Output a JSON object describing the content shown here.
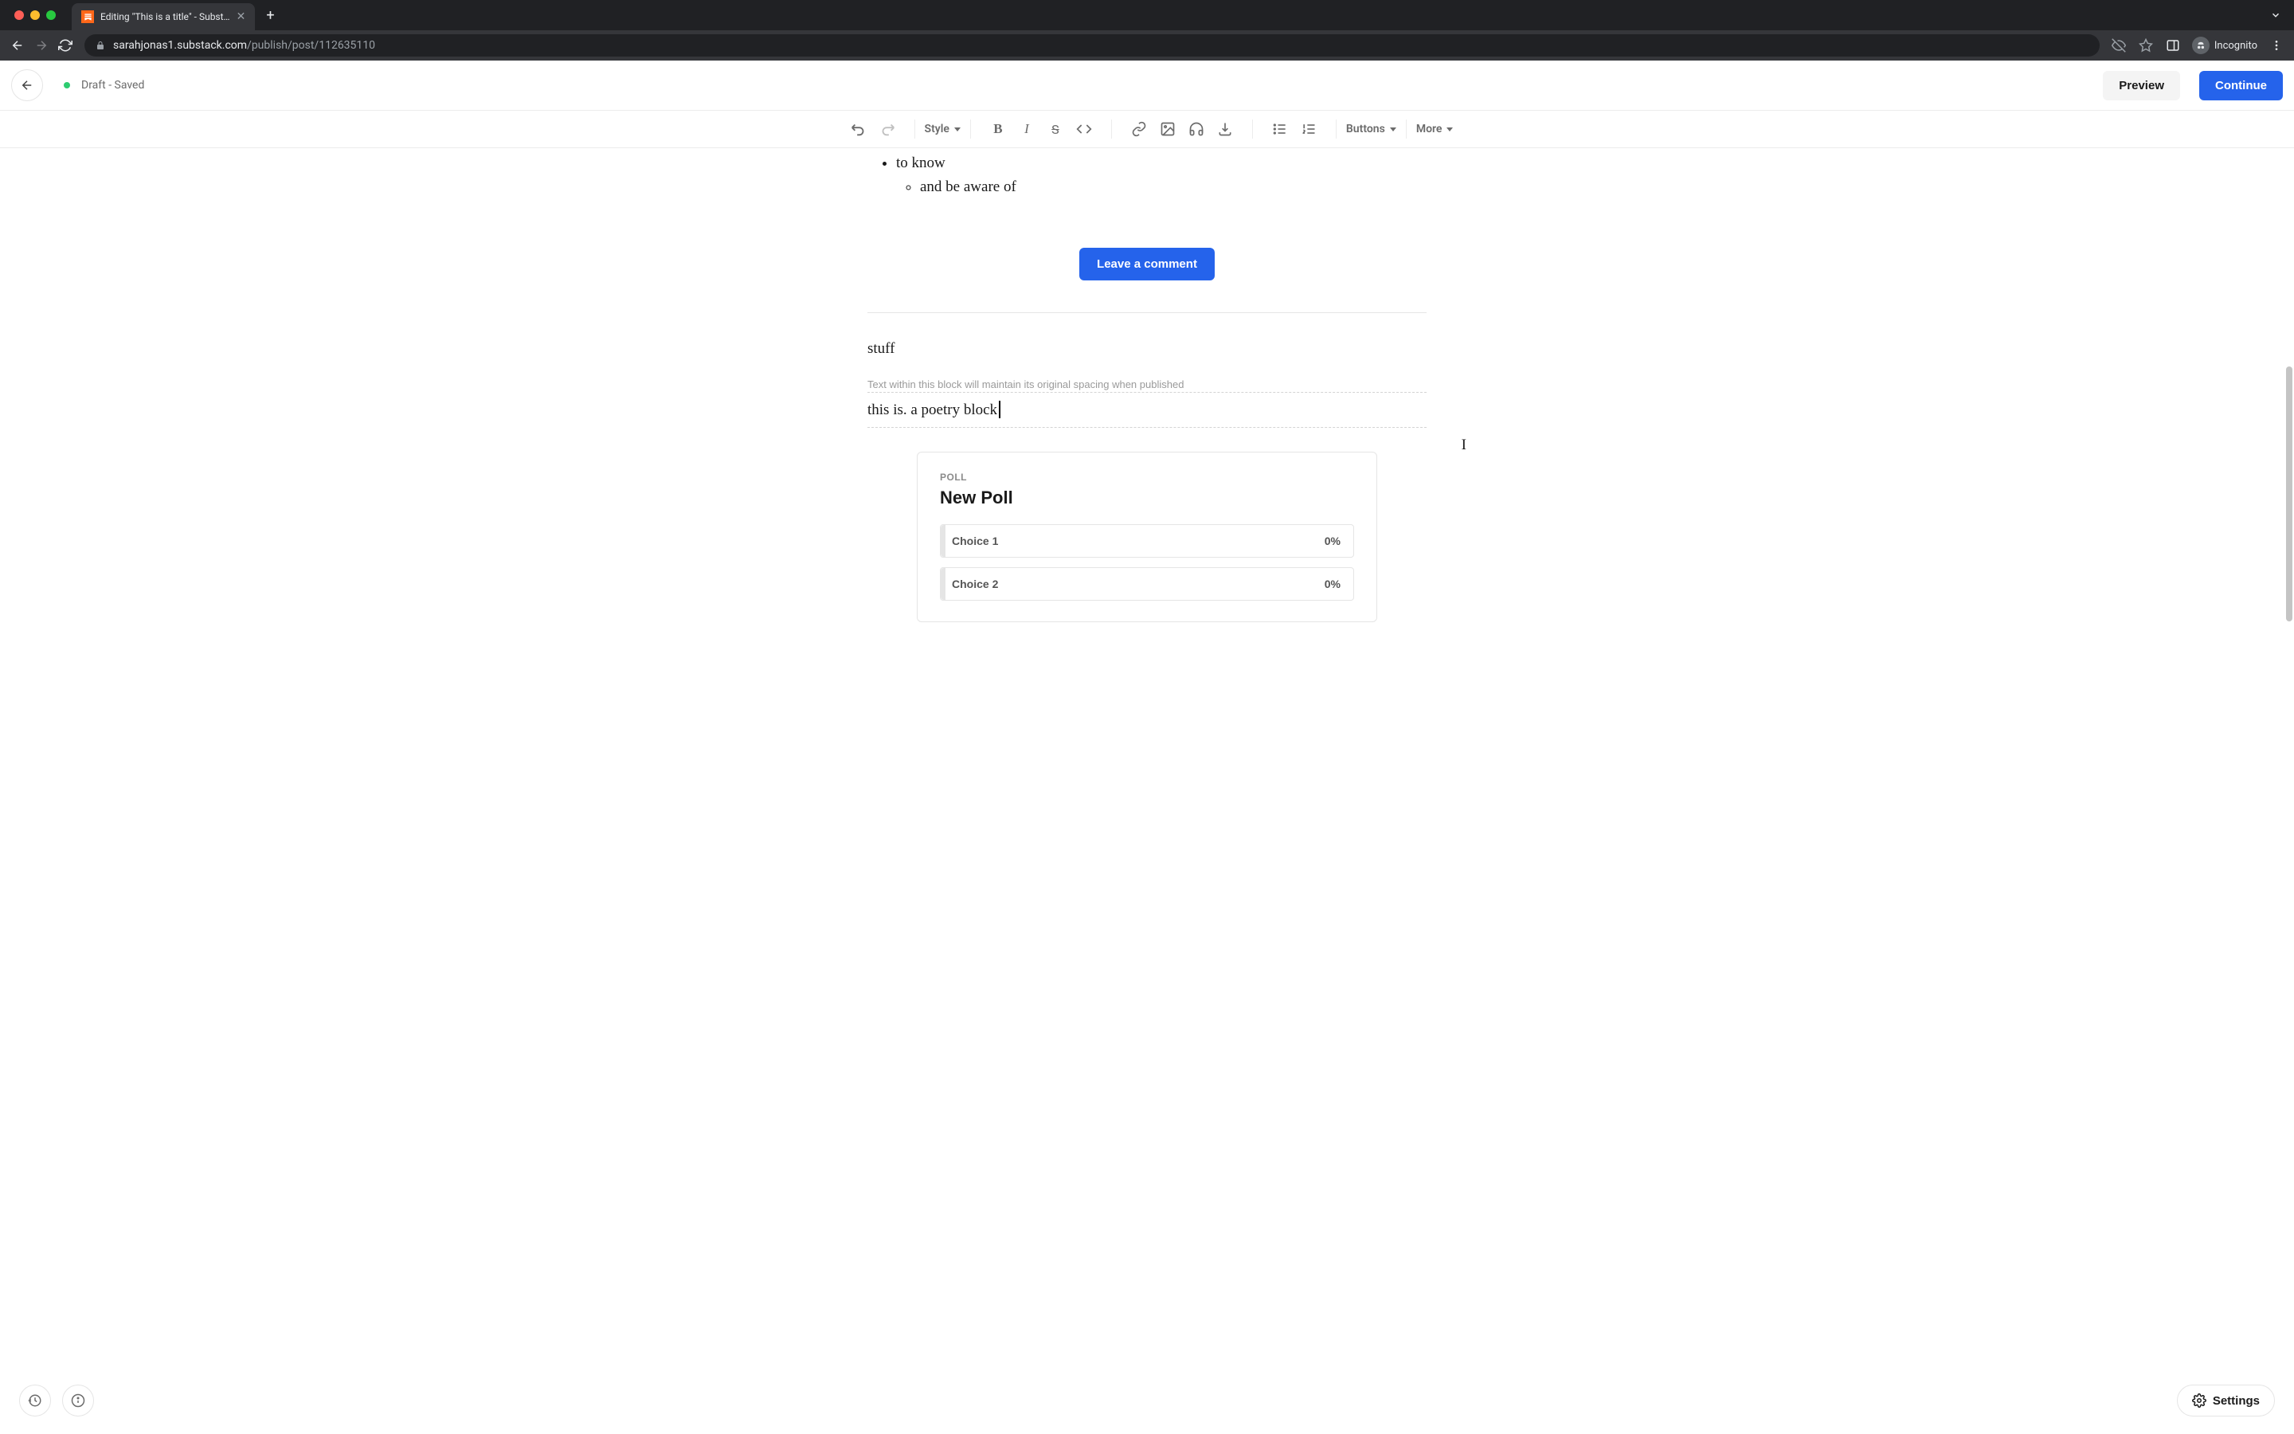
{
  "browser": {
    "tab_title": "Editing \"This is a title\" - Subst…",
    "url_host": "sarahjonas1.substack.com",
    "url_path": "/publish/post/112635110",
    "incognito_label": "Incognito"
  },
  "header": {
    "status": "Draft - Saved",
    "preview": "Preview",
    "continue": "Continue"
  },
  "toolbar": {
    "style": "Style",
    "buttons": "Buttons",
    "more": "More"
  },
  "content": {
    "bullet1": "to know",
    "bullet1_sub": "and be aware of",
    "comment_btn": "Leave a comment",
    "stuff": "stuff",
    "poetry_hint": "Text within this block will maintain its original spacing when published",
    "poetry_text": "this is. a poetry block"
  },
  "poll": {
    "label": "POLL",
    "title": "New Poll",
    "choices": [
      {
        "label": "Choice 1",
        "pct": "0%"
      },
      {
        "label": "Choice 2",
        "pct": "0%"
      }
    ]
  },
  "footer": {
    "settings": "Settings"
  }
}
